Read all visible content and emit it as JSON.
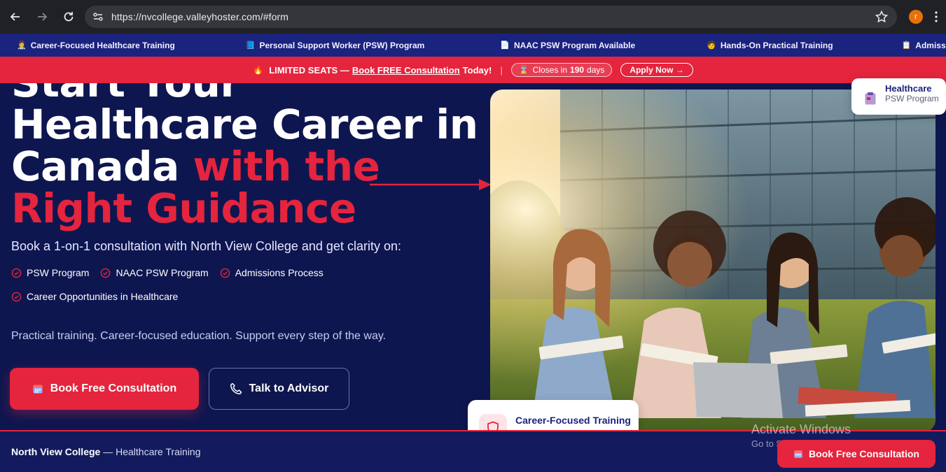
{
  "browser": {
    "url": "https://nvcollege.valleyhoster.com/#form",
    "profile_initial": "r"
  },
  "ticker": [
    {
      "icon": "👩‍⚕️",
      "label": "Career-Focused Healthcare Training"
    },
    {
      "icon": "📘",
      "label": "Personal Support Worker (PSW) Program"
    },
    {
      "icon": "📄",
      "label": "NAAC PSW Program Available"
    },
    {
      "icon": "🧑",
      "label": "Hands-On Practical Training"
    },
    {
      "icon": "📋",
      "label": "Admissions Guidan"
    }
  ],
  "promo": {
    "lead": "LIMITED SEATS —",
    "link": "Book FREE Consultation",
    "tail": "Today!",
    "sep": "|",
    "closes_prefix": "Closes in",
    "closes_days": "190",
    "closes_suffix": "days",
    "apply": "Apply Now →"
  },
  "hero": {
    "line0": "Start Your",
    "line1": "Healthcare Career in",
    "line2_white": "Canada ",
    "line2_accent": "with the",
    "line3_accent": "Right Guidance",
    "subtitle": "Book a 1-on-1 consultation with North View College and get clarity on:",
    "checks": [
      "PSW Program",
      "NAAC PSW Program",
      "Admissions Process",
      "Career Opportunities in Healthcare"
    ],
    "tagline": "Practical training. Career-focused education. Support every step of the way.",
    "primary_cta": "Book Free Consultation",
    "secondary_cta": "Talk to Advisor"
  },
  "badges": {
    "top_title": "Healthcare",
    "top_sub": "PSW Program",
    "bottom_title": "Career-Focused Training"
  },
  "footer": {
    "brand": "North View College",
    "text": " — Healthcare Training",
    "float_cta": "Book Free Consultation"
  },
  "watermark": {
    "line1": "Activate Windows",
    "line2": "Go to Settings to activate Windows."
  },
  "colors": {
    "navy": "#0e1650",
    "accent": "#e5243d"
  }
}
